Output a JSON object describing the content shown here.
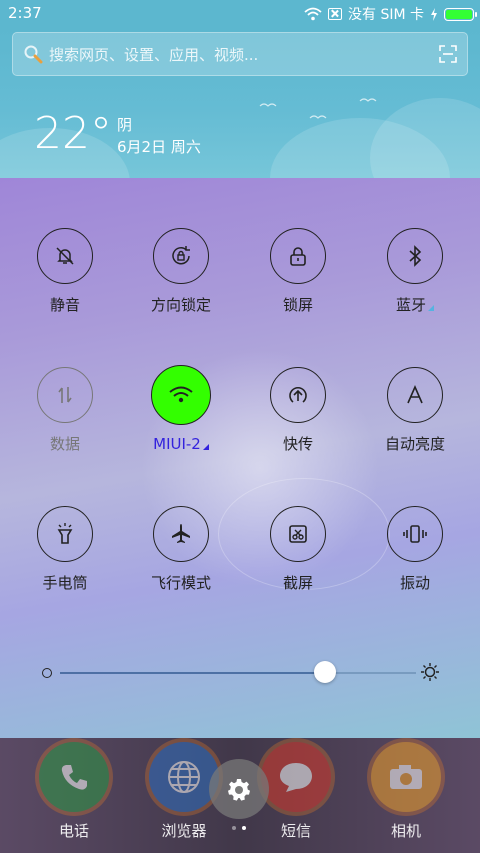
{
  "status_bar": {
    "time": "2:37",
    "carrier": "没有 SIM 卡",
    "battery_color": "#33ff33"
  },
  "search": {
    "placeholder": "搜索网页、设置、应用、视频..."
  },
  "weather": {
    "temperature": "22°",
    "condition": "阴",
    "date": "6月2日 周六"
  },
  "tiles": [
    {
      "label": "静音",
      "icon": "silent-bell-icon"
    },
    {
      "label": "方向锁定",
      "icon": "rotation-lock-icon"
    },
    {
      "label": "锁屏",
      "icon": "lock-icon"
    },
    {
      "label": "蓝牙",
      "icon": "bluetooth-icon"
    },
    {
      "label": "数据",
      "icon": "mobile-data-icon"
    },
    {
      "label": "MIUI-2",
      "icon": "wifi-icon"
    },
    {
      "label": "快传",
      "icon": "quick-transfer-icon"
    },
    {
      "label": "自动亮度",
      "icon": "auto-brightness-icon"
    },
    {
      "label": "手电筒",
      "icon": "flashlight-icon"
    },
    {
      "label": "飞行模式",
      "icon": "airplane-icon"
    },
    {
      "label": "截屏",
      "icon": "screenshot-icon"
    },
    {
      "label": "振动",
      "icon": "vibrate-icon"
    }
  ],
  "brightness": {
    "level": 0.76
  },
  "dock": [
    {
      "label": "电话",
      "icon": "phone-icon"
    },
    {
      "label": "浏览器",
      "icon": "browser-icon"
    },
    {
      "label": "短信",
      "icon": "messages-icon"
    },
    {
      "label": "相机",
      "icon": "camera-icon"
    }
  ],
  "colors": {
    "active_tile": "#33ff00",
    "active_label": "#3322dd",
    "header": "#5cb7cf"
  }
}
